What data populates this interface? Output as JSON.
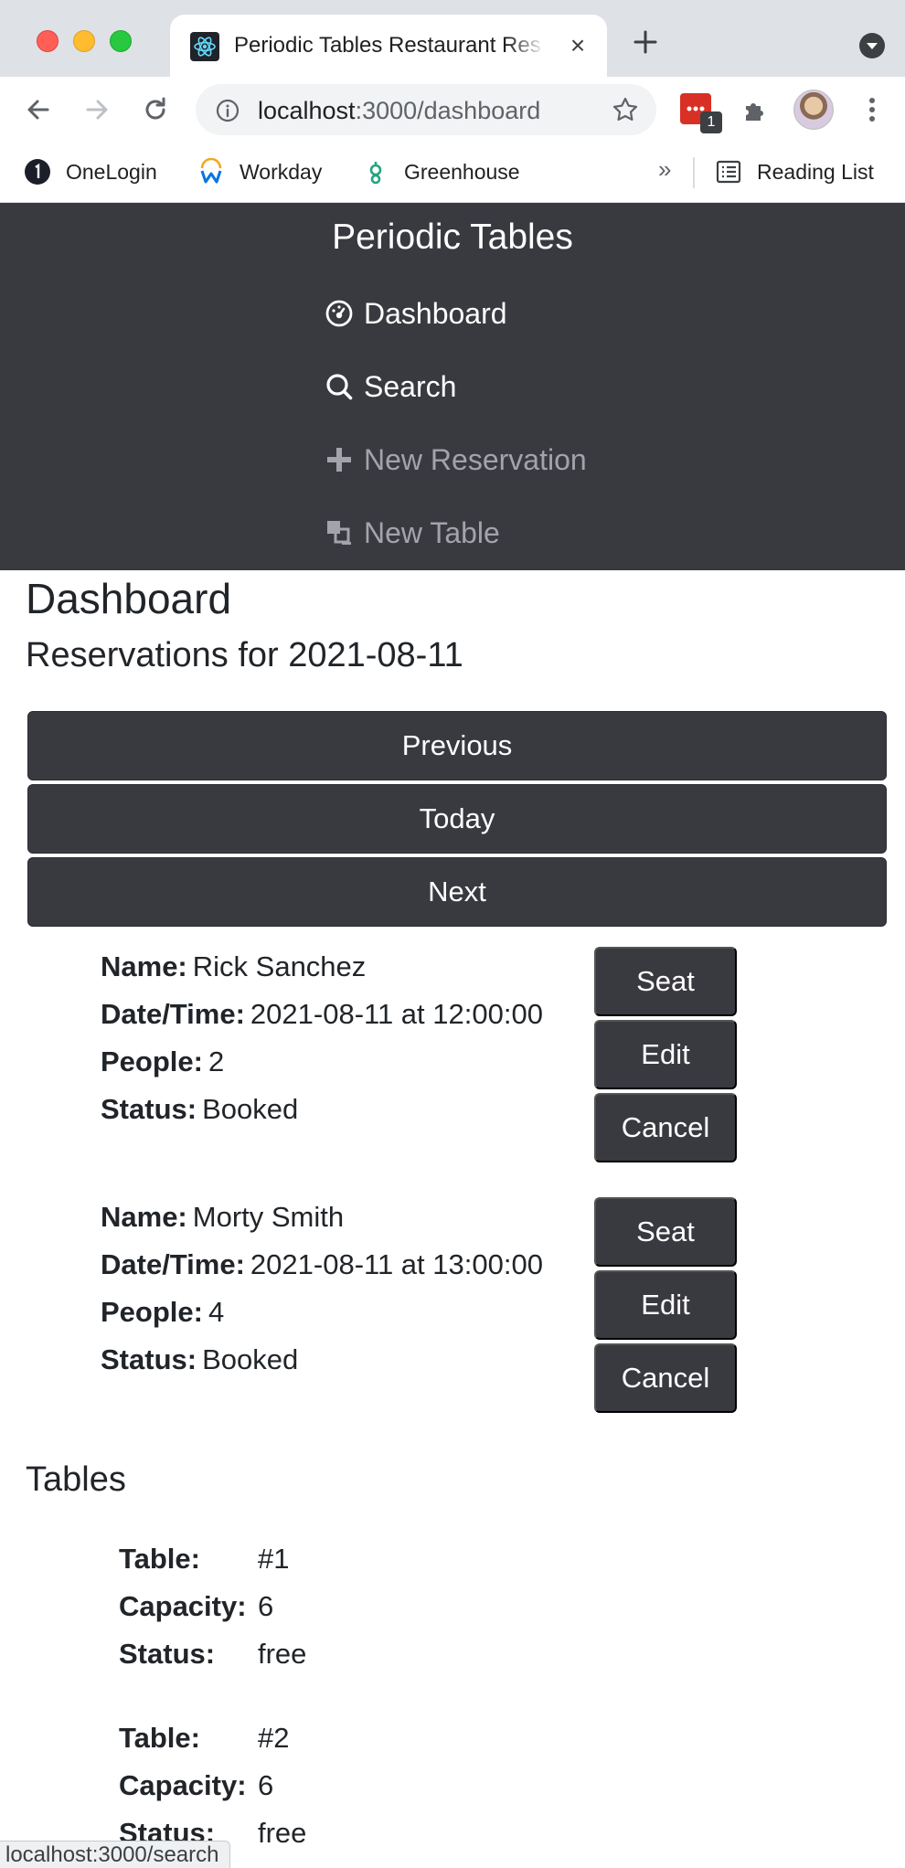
{
  "browser": {
    "tab_title": "Periodic Tables Restaurant Res",
    "url_host": "localhost",
    "url_path": ":3000/dashboard",
    "extension_badge": "1",
    "bookmarks": [
      {
        "label": "OneLogin",
        "icon": "onelogin-icon"
      },
      {
        "label": "Workday",
        "icon": "workday-icon"
      },
      {
        "label": "Greenhouse",
        "icon": "greenhouse-icon"
      }
    ],
    "bookmarks_overflow": "»",
    "reading_list": "Reading List",
    "status_url": "localhost:3000/search"
  },
  "nav": {
    "brand": "Periodic Tables",
    "items": [
      {
        "label": "Dashboard",
        "icon": "dashboard-icon",
        "state": "active"
      },
      {
        "label": "Search",
        "icon": "search-icon",
        "state": "active"
      },
      {
        "label": "New Reservation",
        "icon": "plus-icon",
        "state": "muted"
      },
      {
        "label": "New Table",
        "icon": "table-icon",
        "state": "muted"
      }
    ]
  },
  "page": {
    "title": "Dashboard",
    "subtitle": "Reservations for 2021-08-11",
    "buttons": {
      "previous": "Previous",
      "today": "Today",
      "next": "Next"
    }
  },
  "reservation_labels": {
    "name": "Name:",
    "datetime": "Date/Time:",
    "people": "People:",
    "status": "Status:"
  },
  "reservation_actions": {
    "seat": "Seat",
    "edit": "Edit",
    "cancel": "Cancel"
  },
  "reservations": [
    {
      "name": "Rick Sanchez",
      "datetime": "2021-08-11 at 12:00:00",
      "people": "2",
      "status": "Booked"
    },
    {
      "name": "Morty Smith",
      "datetime": "2021-08-11 at 13:00:00",
      "people": "4",
      "status": "Booked"
    }
  ],
  "tables_section": {
    "title": "Tables",
    "labels": {
      "table": "Table:",
      "capacity": "Capacity:",
      "status": "Status:"
    },
    "tables": [
      {
        "table": "#1",
        "capacity": "6",
        "status": "free"
      },
      {
        "table": "#2",
        "capacity": "6",
        "status": "free"
      }
    ]
  },
  "colors": {
    "navbar": "#393940",
    "button": "#393940",
    "nav_muted_text": "#a3a3ab"
  }
}
